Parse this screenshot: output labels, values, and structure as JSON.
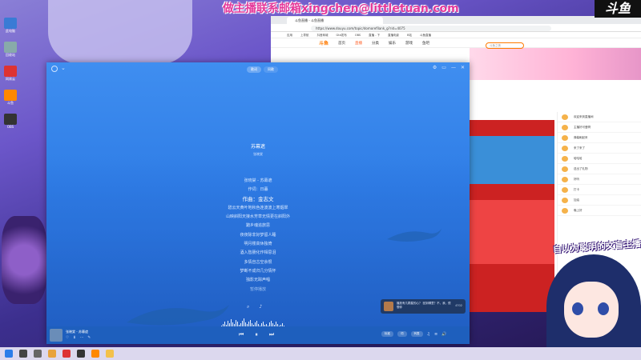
{
  "overlay": {
    "contact_text": "做主播联系邮箱xingchen@littletuan.com",
    "logo_text": "斗鱼"
  },
  "desktop": {
    "icons": [
      {
        "label": "此电脑",
        "color": "#3a7bd5"
      },
      {
        "label": "回收站",
        "color": "#8aa"
      },
      {
        "label": "网易云",
        "color": "#d33"
      },
      {
        "label": "斗鱼",
        "color": "#f80"
      },
      {
        "label": "OBS",
        "color": "#333"
      }
    ]
  },
  "player": {
    "tabs": [
      "歌词",
      "同歌"
    ],
    "window_controls": [
      "⚙",
      "▭",
      "—",
      "✕"
    ],
    "song_title": "苏幕遮",
    "singer": "张晓棠",
    "lyrics": [
      {
        "text": "张晓棠 - 苏幕遮",
        "state": "normal"
      },
      {
        "text": "作词：日暮",
        "state": "normal"
      },
      {
        "text": "作曲：金志文",
        "state": "active"
      },
      {
        "text": "碧云天黄叶地秋色连波波上寒烟翠",
        "state": "normal"
      },
      {
        "text": "山映斜阳天接水芳草无情更在斜阳外",
        "state": "normal"
      },
      {
        "text": "黯乡魂追旅思",
        "state": "normal"
      },
      {
        "text": "夜夜除非好梦留人睡",
        "state": "normal"
      },
      {
        "text": "明月楼高休独倚",
        "state": "normal"
      },
      {
        "text": "酒入愁肠化作相思泪",
        "state": "normal"
      },
      {
        "text": "多情自古空余恨",
        "state": "normal"
      },
      {
        "text": "梦断不成归几分情怀",
        "state": "normal"
      },
      {
        "text": "独影无踪声唱",
        "state": "normal"
      },
      {
        "text": "暂停播放",
        "state": "dim"
      }
    ],
    "lyric_tools": [
      "⌕",
      "♪"
    ],
    "comment": {
      "text": "播放有几颗星的心？ 回到哪里？不，我，很想你",
      "likes": "4702"
    },
    "bottom": {
      "song": "张晓棠 - 苏幕遮",
      "icons": [
        "♡",
        "⬇",
        "⋯",
        "✎"
      ],
      "controls": [
        "⏮",
        "⏸",
        "⏭"
      ],
      "chips": [
        "标准",
        "词",
        "列表"
      ],
      "right_icons": [
        "♫",
        "≡",
        "🔊"
      ]
    }
  },
  "browser": {
    "tab_title": "斗鱼直播 - 斗鱼直播",
    "url": "https://www.douyu.com/topic/domorefilank_g?rid=4075",
    "bookmarks": [
      "应用",
      "上导航",
      "抖音商城",
      "Gtd发布",
      "OBS",
      "直播 - 下",
      "直播电影",
      "B站",
      "斗鱼直播"
    ],
    "nav": [
      "斗鱼",
      "首页",
      "直播",
      "分类",
      "娱乐",
      "游戏",
      "鱼吧"
    ],
    "search_placeholder": "斗鱼之夜",
    "chat": [
      "欢迎来到直播间",
      "主播好可爱啊",
      "弹幕刷起来",
      "来了来了",
      "哈哈哈",
      "送出了礼物",
      "好听",
      "打卡",
      "加油",
      "晚上好"
    ]
  },
  "streamer_badge": "自以为聪明的文盲主播"
}
